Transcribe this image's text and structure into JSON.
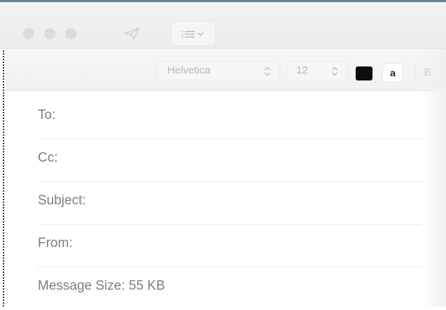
{
  "toolbar": {
    "traffic_lights": [
      "close",
      "minimize",
      "zoom"
    ],
    "send_icon": "paper-plane-icon",
    "header_menu_icon": "list-chevron-icon"
  },
  "format_bar": {
    "font_family": "Helvetica",
    "font_size": "12",
    "text_color": "#0d0d0d",
    "highlight_label": "a",
    "bold_label": "B"
  },
  "fields": {
    "to_label": "To:",
    "cc_label": "Cc:",
    "subject_label": "Subject:",
    "from_label": "From:",
    "message_size_label": "Message Size: 55 KB"
  },
  "colors": {
    "accent": "#6c7f95",
    "label_text": "#7e7e7e"
  }
}
